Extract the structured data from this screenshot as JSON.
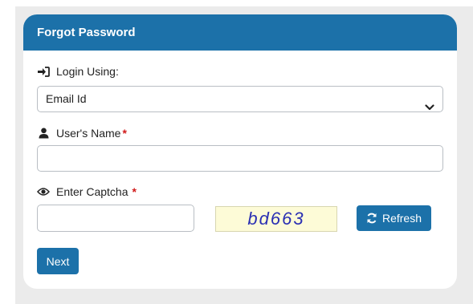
{
  "form": {
    "title": "Forgot Password",
    "login_using": {
      "label": "Login Using:",
      "selected": "Email Id",
      "icon": "sign-in-icon"
    },
    "user_name": {
      "label": "User's Name",
      "required_mark": "*",
      "value": "",
      "icon": "user-icon"
    },
    "captcha": {
      "label": "Enter Captcha",
      "required_mark": "*",
      "value": "",
      "image_text": "bd663",
      "icon": "eye-icon"
    },
    "refresh_label": "Refresh",
    "next_label": "Next"
  },
  "colors": {
    "primary": "#1c71a9",
    "required": "#d11a1a",
    "captcha_bg": "#fdfbd7",
    "captcha_text": "#2a2fb3"
  }
}
